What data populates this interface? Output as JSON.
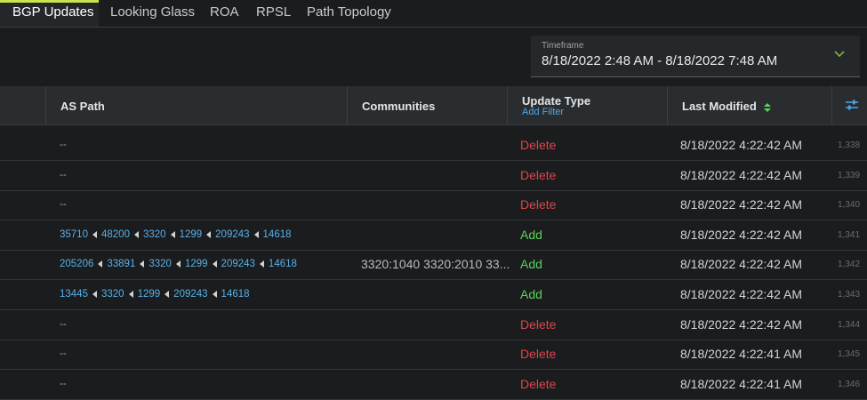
{
  "tabs": [
    {
      "label": "BGP Updates",
      "active": true
    },
    {
      "label": "Looking Glass",
      "active": false
    },
    {
      "label": "ROA",
      "active": false
    },
    {
      "label": "RPSL",
      "active": false
    },
    {
      "label": "Path Topology",
      "active": false
    }
  ],
  "timeframe": {
    "label": "Timeframe",
    "value": "8/18/2022 2:48 AM - 8/18/2022 7:48 AM",
    "chevron_icon": "chevron-down-icon"
  },
  "table": {
    "headers": {
      "as_path": "AS Path",
      "communities": "Communities",
      "update_type": "Update Type",
      "add_filter": "Add Filter",
      "last_modified": "Last Modified",
      "sort_icon": "sort-icon",
      "settings_icon": "column-settings-icon"
    },
    "rows": [
      {
        "as_path": [],
        "as_path_text": "--",
        "communities": "",
        "update_type": "Delete",
        "last_modified": "8/18/2022 4:22:42 AM",
        "index": "1,338"
      },
      {
        "as_path": [],
        "as_path_text": "--",
        "communities": "",
        "update_type": "Delete",
        "last_modified": "8/18/2022 4:22:42 AM",
        "index": "1,339"
      },
      {
        "as_path": [],
        "as_path_text": "--",
        "communities": "",
        "update_type": "Delete",
        "last_modified": "8/18/2022 4:22:42 AM",
        "index": "1,340"
      },
      {
        "as_path": [
          "35710",
          "48200",
          "3320",
          "1299",
          "209243",
          "14618"
        ],
        "as_path_text": "",
        "communities": "",
        "update_type": "Add",
        "last_modified": "8/18/2022 4:22:42 AM",
        "index": "1,341"
      },
      {
        "as_path": [
          "205206",
          "33891",
          "3320",
          "1299",
          "209243",
          "14618"
        ],
        "as_path_text": "",
        "communities": "3320:1040 3320:2010 33...",
        "update_type": "Add",
        "last_modified": "8/18/2022 4:22:42 AM",
        "index": "1,342"
      },
      {
        "as_path": [
          "13445",
          "3320",
          "1299",
          "209243",
          "14618"
        ],
        "as_path_text": "",
        "communities": "",
        "update_type": "Add",
        "last_modified": "8/18/2022 4:22:42 AM",
        "index": "1,343"
      },
      {
        "as_path": [],
        "as_path_text": "--",
        "communities": "",
        "update_type": "Delete",
        "last_modified": "8/18/2022 4:22:42 AM",
        "index": "1,344"
      },
      {
        "as_path": [],
        "as_path_text": "--",
        "communities": "",
        "update_type": "Delete",
        "last_modified": "8/18/2022 4:22:41 AM",
        "index": "1,345"
      },
      {
        "as_path": [],
        "as_path_text": "--",
        "communities": "",
        "update_type": "Delete",
        "last_modified": "8/18/2022 4:22:41 AM",
        "index": "1,346"
      }
    ]
  },
  "colors": {
    "accent": "#c8e64a",
    "delete": "#e0444c",
    "add": "#5cd35c",
    "link": "#5ab0e8"
  }
}
